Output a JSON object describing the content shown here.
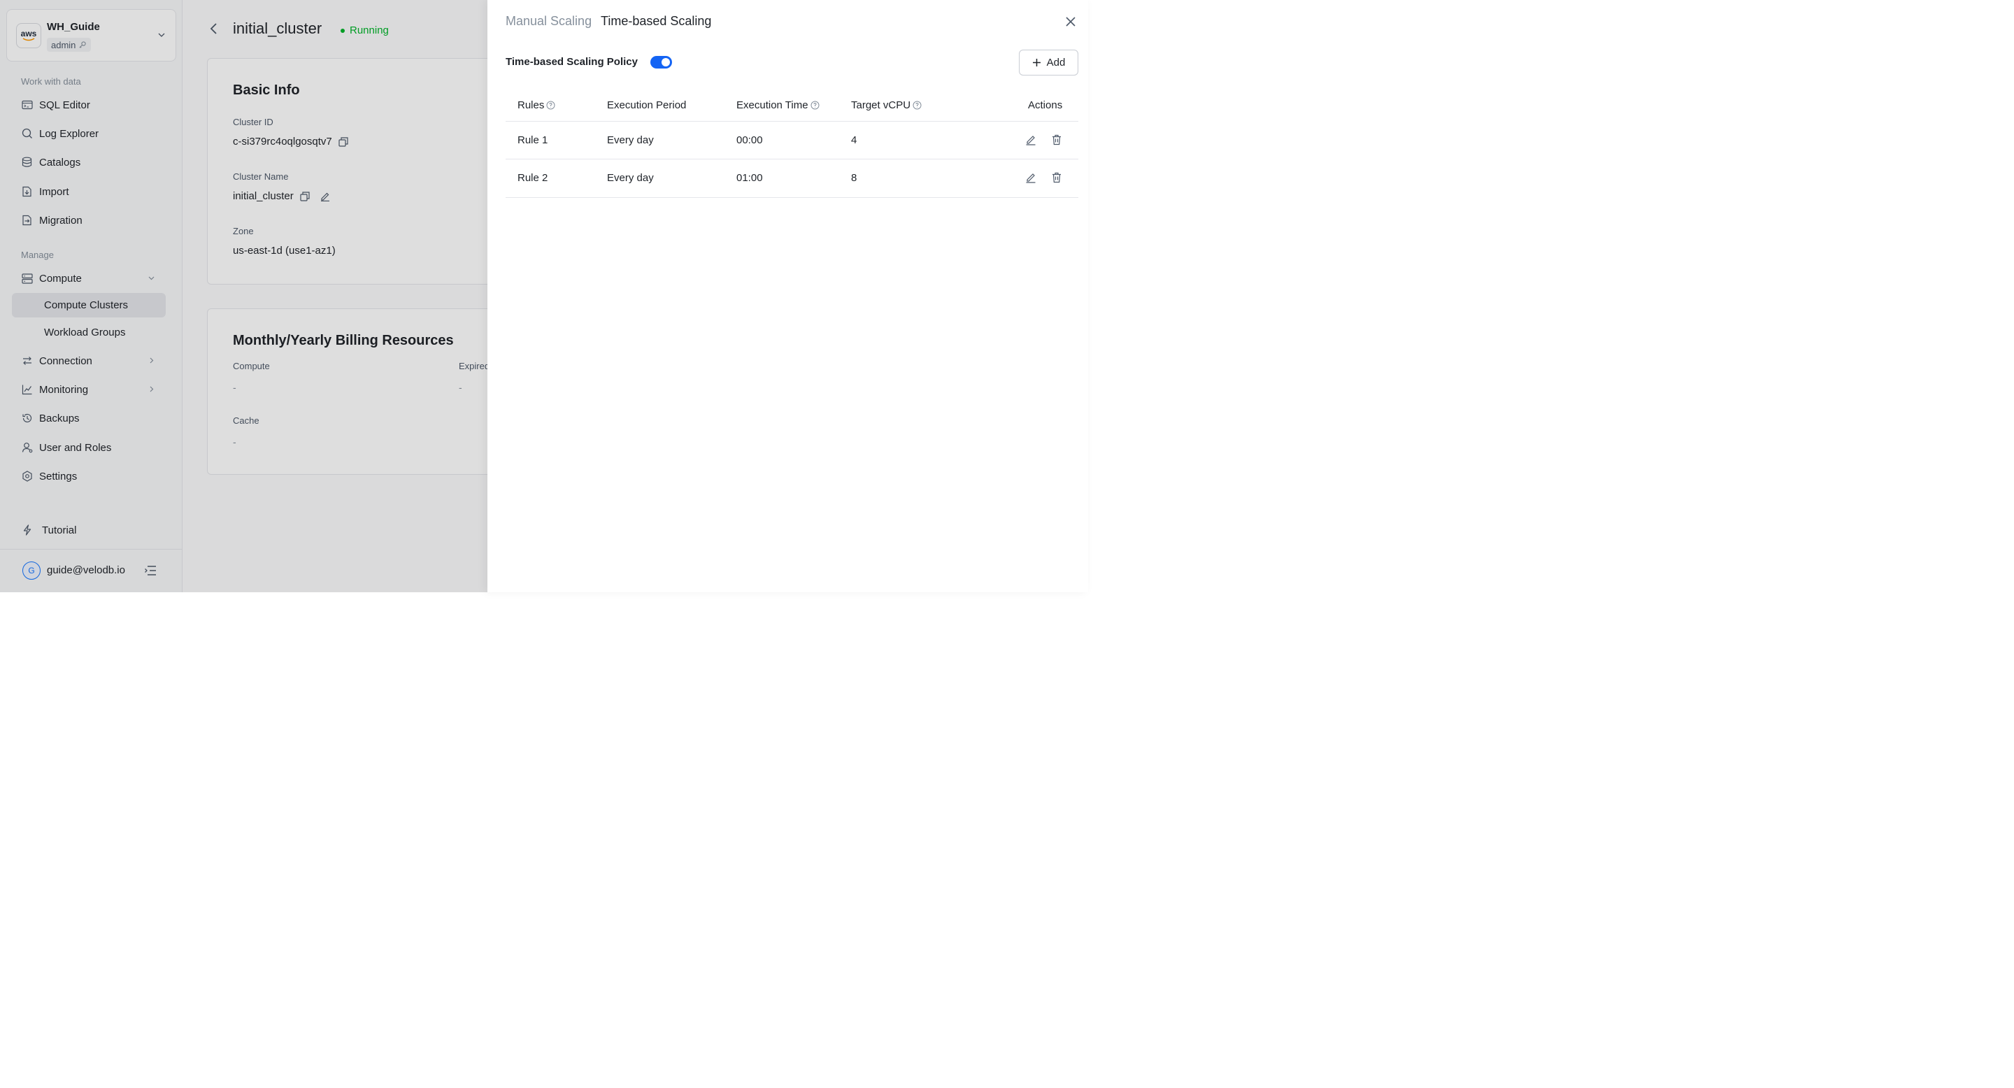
{
  "workspace": {
    "logo": "aws",
    "name": "WH_Guide",
    "role": "admin"
  },
  "sidebar": {
    "section_work": "Work with data",
    "work_items": [
      {
        "label": "SQL Editor",
        "icon": "sql-editor-icon"
      },
      {
        "label": "Log Explorer",
        "icon": "search-icon"
      },
      {
        "label": "Catalogs",
        "icon": "database-icon"
      },
      {
        "label": "Import",
        "icon": "import-icon"
      },
      {
        "label": "Migration",
        "icon": "migration-icon"
      }
    ],
    "section_manage": "Manage",
    "compute": {
      "label": "Compute",
      "icon": "server-icon"
    },
    "compute_children": [
      "Compute Clusters",
      "Workload Groups"
    ],
    "connection": "Connection",
    "monitoring": "Monitoring",
    "backups": "Backups",
    "users": "User and Roles",
    "settings": "Settings",
    "tutorial": "Tutorial",
    "user_initial": "G",
    "user_email": "guide@velodb.io"
  },
  "main": {
    "cluster_title": "initial_cluster",
    "status": "Running",
    "basic_info": {
      "heading": "Basic Info",
      "cluster_id_label": "Cluster ID",
      "cluster_id": "c-si379rc4oqlgosqtv7",
      "cluster_name_label": "Cluster Name",
      "cluster_name": "initial_cluster",
      "zone_label": "Zone",
      "zone": "us-east-1d (use1-az1)"
    },
    "billing": {
      "heading": "Monthly/Yearly Billing Resources",
      "compute_label": "Compute",
      "compute_value": "-",
      "expired_label": "Expired",
      "expired_value": "-",
      "cache_label": "Cache",
      "cache_value": "-"
    }
  },
  "drawer": {
    "tabs": [
      "Manual Scaling",
      "Time-based Scaling"
    ],
    "active_tab": "Time-based Scaling",
    "policy_label": "Time-based Scaling Policy",
    "policy_enabled": true,
    "add_label": "Add",
    "columns": {
      "rules": "Rules",
      "period": "Execution Period",
      "time": "Execution Time",
      "vcpu": "Target vCPU",
      "actions": "Actions"
    },
    "rows": [
      {
        "rule": "Rule 1",
        "period": "Every day",
        "time": "00:00",
        "vcpu": "4"
      },
      {
        "rule": "Rule 2",
        "period": "Every day",
        "time": "01:00",
        "vcpu": "8"
      }
    ],
    "accent": "#1464f4"
  }
}
